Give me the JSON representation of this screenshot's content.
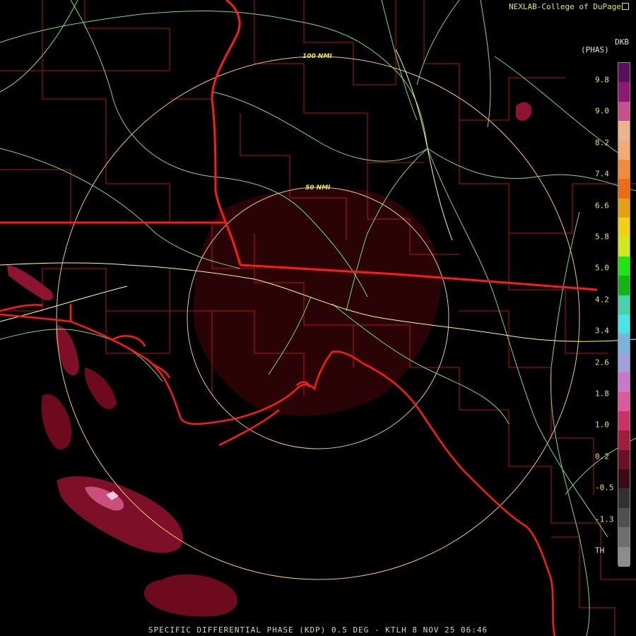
{
  "header": {
    "credit": "NEXLAB-College of DuPage",
    "units_top": "DKB",
    "units_bottom": "(PHAS)"
  },
  "legend": {
    "ticks": [
      "9.8",
      "9.0",
      "8.2",
      "7.4",
      "6.6",
      "5.8",
      "5.0",
      "4.2",
      "3.4",
      "2.6",
      "1.8",
      "1.0",
      "0.2",
      "-0.5",
      "-1.3",
      "TH"
    ],
    "colors": [
      "#5a0f5a",
      "#8c1a73",
      "#c8508c",
      "#ebb48c",
      "#f5aa73",
      "#f08c3c",
      "#eb6e14",
      "#e6a014",
      "#f0d214",
      "#d2e61e",
      "#1ee614",
      "#14b414",
      "#46d2aa",
      "#46e6e6",
      "#78b4dc",
      "#a0a0dc",
      "#c878c8",
      "#dc5a9b",
      "#c83264",
      "#a01e3c",
      "#6e0f28",
      "#3c0a14",
      "#323232",
      "#505050",
      "#6e6e6e",
      "#8c8c8c"
    ]
  },
  "map": {
    "ring_labels": [
      "100 NMI",
      "50 NMI"
    ],
    "colors": {
      "state_border": "#ff1a1a",
      "county": "#b41414",
      "road": "#78dc78",
      "interstate": "#ffff78",
      "ring": "#f0c878",
      "precip": "#6e0a1e"
    }
  },
  "footer": {
    "caption": "SPECIFIC DIFFERENTIAL PHASE (KDP) 0.5 DEG - KTLH 8 NOV 25 06:46"
  }
}
